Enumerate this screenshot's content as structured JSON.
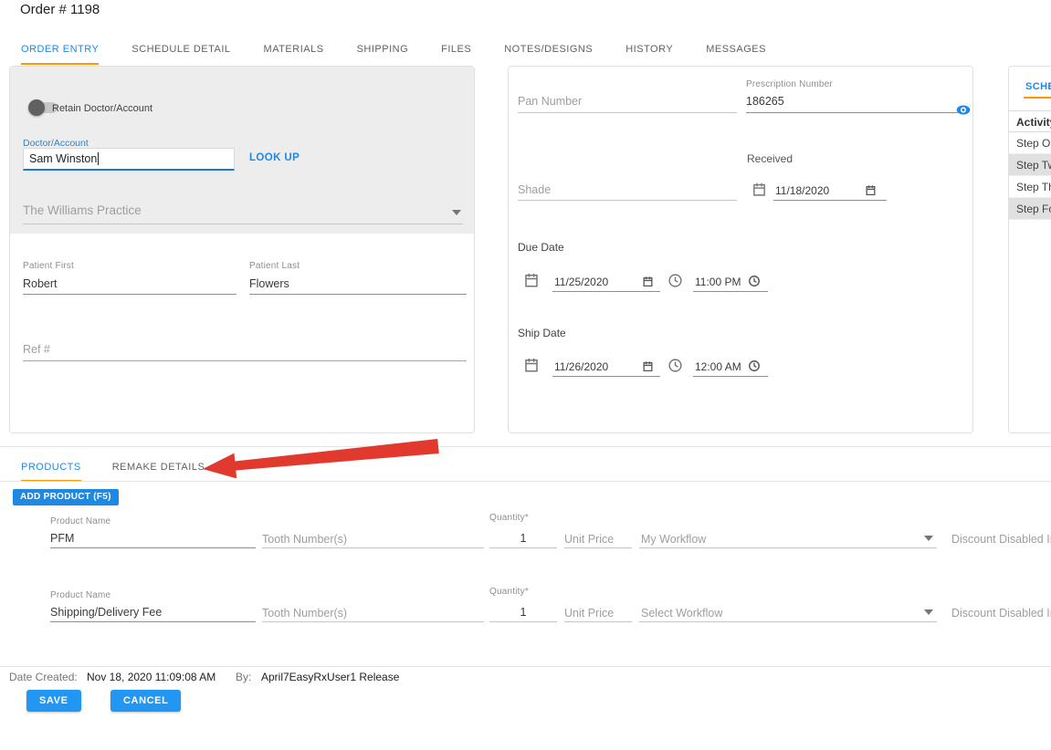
{
  "page": {
    "title": "Order # 1198"
  },
  "main_tabs": {
    "active": "ORDER ENTRY",
    "items": [
      {
        "label": "ORDER ENTRY"
      },
      {
        "label": "SCHEDULE DETAIL"
      },
      {
        "label": "MATERIALS"
      },
      {
        "label": "SHIPPING"
      },
      {
        "label": "FILES"
      },
      {
        "label": "NOTES/DESIGNS"
      },
      {
        "label": "HISTORY"
      },
      {
        "label": "MESSAGES"
      }
    ]
  },
  "doctor_card": {
    "retain_label": "Retain Doctor/Account",
    "doctor_label": "Doctor/Account",
    "doctor_value": "Sam Winston",
    "lookup_label": "LOOK UP",
    "practice_value": "The Williams Practice",
    "patient_first_label": "Patient First",
    "patient_first_value": "Robert",
    "patient_last_label": "Patient Last",
    "patient_last_value": "Flowers",
    "ref_placeholder": "Ref #"
  },
  "details_card": {
    "pan_placeholder": "Pan Number",
    "prescription_label": "Prescription Number",
    "prescription_value": "186265",
    "shade_placeholder": "Shade",
    "received_label": "Received",
    "received_date": "11/18/2020",
    "due_date_label": "Due Date",
    "due_date": "11/25/2020",
    "due_time": "11:00 PM",
    "ship_date_label": "Ship Date",
    "ship_date": "11/26/2020",
    "ship_time": "12:00 AM"
  },
  "schedule_card": {
    "tab_label": "SCHE",
    "header": "Activity",
    "steps": [
      {
        "label": "Step O",
        "highlighted": false
      },
      {
        "label": "Step Tw",
        "highlighted": true
      },
      {
        "label": "Step Th",
        "highlighted": false
      },
      {
        "label": "Step Fo",
        "highlighted": true
      }
    ]
  },
  "products_section": {
    "active_tab": "PRODUCTS",
    "tabs": [
      {
        "label": "PRODUCTS"
      },
      {
        "label": "REMAKE DETAILS"
      }
    ],
    "add_button_label": "ADD PRODUCT (F5)",
    "field_labels": {
      "product_name": "Product Name",
      "quantity": "Quantity*"
    },
    "rows": [
      {
        "product_name": "PFM",
        "tooth_placeholder": "Tooth Number(s)",
        "quantity": "1",
        "unit_price_placeholder": "Unit Price",
        "workflow": "My Workflow",
        "discount_note": "Discount Disabled In"
      },
      {
        "product_name": "Shipping/Delivery Fee",
        "tooth_placeholder": "Tooth Number(s)",
        "quantity": "1",
        "unit_price_placeholder": "Unit Price",
        "workflow": "Select Workflow",
        "discount_note": "Discount Disabled In"
      }
    ]
  },
  "footer": {
    "date_created_label": "Date Created:",
    "date_created_value": "Nov 18, 2020 11:09:08 AM",
    "by_label": "By:",
    "by_value": "April7EasyRxUser1 Release",
    "save_label": "SAVE",
    "cancel_label": "CANCEL"
  },
  "colors": {
    "accent_blue": "#1e88e5",
    "button_blue": "#2196f3",
    "active_tab_underline": "#ff9800",
    "arrow_red": "#e2392e"
  }
}
